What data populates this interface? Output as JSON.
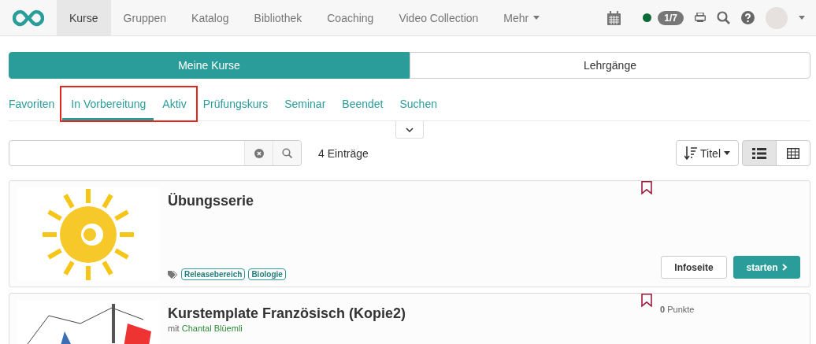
{
  "nav": {
    "items": [
      {
        "label": "Kurse",
        "selected": true
      },
      {
        "label": "Gruppen",
        "selected": false
      },
      {
        "label": "Katalog",
        "selected": false
      },
      {
        "label": "Bibliothek",
        "selected": false
      },
      {
        "label": "Coaching",
        "selected": false
      },
      {
        "label": "Video Collection",
        "selected": false
      },
      {
        "label": "Mehr",
        "selected": false,
        "dropdown": true
      }
    ],
    "online": true,
    "counter": "1/7"
  },
  "segments": [
    {
      "label": "Meine Kurse",
      "selected": true
    },
    {
      "label": "Lehrgänge",
      "selected": false
    }
  ],
  "tabs": [
    {
      "label": "Favoriten",
      "selected": false
    },
    {
      "label": "In Vorbereitung",
      "selected": true
    },
    {
      "label": "Aktiv",
      "selected": false
    },
    {
      "label": "Prüfungskurs",
      "selected": false
    },
    {
      "label": "Seminar",
      "selected": false
    },
    {
      "label": "Beendet",
      "selected": false
    },
    {
      "label": "Suchen",
      "selected": false
    }
  ],
  "count": "4 Einträge",
  "sort": "Titel",
  "views": [
    {
      "kind": "list",
      "selected": true
    },
    {
      "kind": "table",
      "selected": false
    }
  ],
  "courses": [
    {
      "title": "Übungsserie",
      "tags": [
        "Releasebereich",
        "Biologie"
      ],
      "buttons": [
        "Infoseite",
        "starten"
      ]
    },
    {
      "title": "Kurstemplate Französisch (Kopie2)",
      "points": "**0** Punkte",
      "author_prefix": "mit",
      "author": "Chantal Blüemli"
    }
  ]
}
